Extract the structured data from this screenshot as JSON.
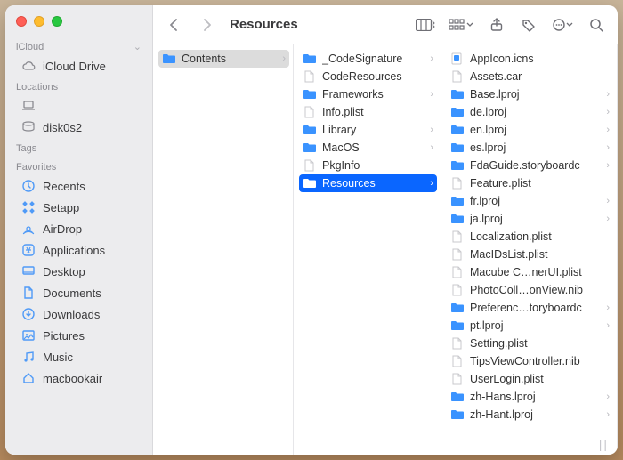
{
  "window": {
    "title": "Resources"
  },
  "sidebar": {
    "sections": [
      {
        "label": "iCloud",
        "collapsible": true,
        "items": [
          {
            "label": "iCloud Drive",
            "icon": "cloud-icon"
          }
        ]
      },
      {
        "label": "Locations",
        "items": [
          {
            "label": "",
            "icon": "laptop-icon"
          },
          {
            "label": "disk0s2",
            "icon": "disk-icon"
          }
        ]
      },
      {
        "label": "Tags",
        "items": []
      },
      {
        "label": "Favorites",
        "items": [
          {
            "label": "Recents",
            "icon": "clock-icon"
          },
          {
            "label": "Setapp",
            "icon": "setapp-icon"
          },
          {
            "label": "AirDrop",
            "icon": "airdrop-icon"
          },
          {
            "label": "Applications",
            "icon": "app-icon"
          },
          {
            "label": "Desktop",
            "icon": "desktop-icon"
          },
          {
            "label": "Documents",
            "icon": "document-icon"
          },
          {
            "label": "Downloads",
            "icon": "download-icon"
          },
          {
            "label": "Pictures",
            "icon": "pictures-icon"
          },
          {
            "label": "Music",
            "icon": "music-icon"
          },
          {
            "label": "macbookair",
            "icon": "home-icon"
          }
        ]
      }
    ]
  },
  "columns": [
    {
      "items": [
        {
          "name": "Contents",
          "icon": "folder",
          "arrow": true,
          "selected": "gray"
        }
      ]
    },
    {
      "items": [
        {
          "name": "_CodeSignature",
          "icon": "folder",
          "arrow": true
        },
        {
          "name": "CodeResources",
          "icon": "file"
        },
        {
          "name": "Frameworks",
          "icon": "folder",
          "arrow": true
        },
        {
          "name": "Info.plist",
          "icon": "file"
        },
        {
          "name": "Library",
          "icon": "folder",
          "arrow": true
        },
        {
          "name": "MacOS",
          "icon": "folder",
          "arrow": true
        },
        {
          "name": "PkgInfo",
          "icon": "file"
        },
        {
          "name": "Resources",
          "icon": "folder",
          "arrow": true,
          "selected": "blue"
        }
      ]
    },
    {
      "items": [
        {
          "name": "AppIcon.icns",
          "icon": "icns"
        },
        {
          "name": "Assets.car",
          "icon": "file"
        },
        {
          "name": "Base.lproj",
          "icon": "folder",
          "arrow": true
        },
        {
          "name": "de.lproj",
          "icon": "folder",
          "arrow": true
        },
        {
          "name": "en.lproj",
          "icon": "folder",
          "arrow": true
        },
        {
          "name": "es.lproj",
          "icon": "folder",
          "arrow": true
        },
        {
          "name": "FdaGuide.storyboardc",
          "icon": "folder",
          "arrow": true
        },
        {
          "name": "Feature.plist",
          "icon": "file"
        },
        {
          "name": "fr.lproj",
          "icon": "folder",
          "arrow": true
        },
        {
          "name": "ja.lproj",
          "icon": "folder",
          "arrow": true
        },
        {
          "name": "Localization.plist",
          "icon": "file"
        },
        {
          "name": "MacIDsList.plist",
          "icon": "file"
        },
        {
          "name": "Macube C…nerUI.plist",
          "icon": "file"
        },
        {
          "name": "PhotoColl…onView.nib",
          "icon": "file"
        },
        {
          "name": "Preferenc…toryboardc",
          "icon": "folder",
          "arrow": true
        },
        {
          "name": "pt.lproj",
          "icon": "folder",
          "arrow": true
        },
        {
          "name": "Setting.plist",
          "icon": "file"
        },
        {
          "name": "TipsViewController.nib",
          "icon": "file"
        },
        {
          "name": "UserLogin.plist",
          "icon": "file"
        },
        {
          "name": "zh-Hans.lproj",
          "icon": "folder",
          "arrow": true
        },
        {
          "name": "zh-Hant.lproj",
          "icon": "folder",
          "arrow": true
        }
      ]
    }
  ],
  "icons": {
    "folder": "folder-icon",
    "file": "file-icon",
    "icns": "icns-icon"
  }
}
